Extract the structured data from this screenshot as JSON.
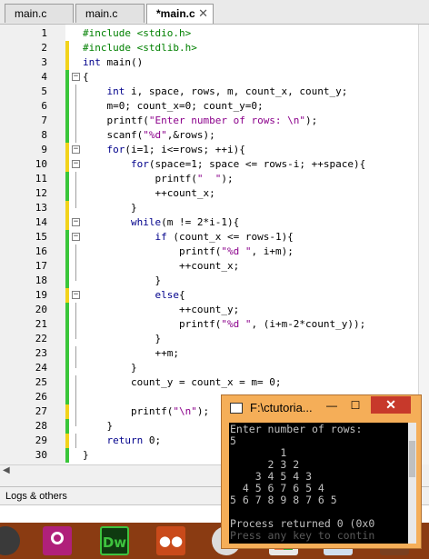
{
  "tabs": [
    {
      "label": "main.c",
      "active": false
    },
    {
      "label": "main.c",
      "active": false
    },
    {
      "label": "*main.c",
      "active": true
    }
  ],
  "editor": {
    "lines": [
      {
        "n": "1",
        "code": "#include <stdio.h>"
      },
      {
        "n": "2",
        "code": "#include <stdlib.h>"
      },
      {
        "n": "3",
        "code": "int main()"
      },
      {
        "n": "4",
        "code": "{"
      },
      {
        "n": "5",
        "code": "    int i, space, rows, m, count_x, count_y;"
      },
      {
        "n": "6",
        "code": "    m=0; count_x=0; count_y=0;"
      },
      {
        "n": "7",
        "code": "    printf(\"Enter number of rows: \\n\");"
      },
      {
        "n": "8",
        "code": "    scanf(\"%d\",&rows);"
      },
      {
        "n": "9",
        "code": "    for(i=1; i<=rows; ++i){"
      },
      {
        "n": "10",
        "code": "        for(space=1; space <= rows-i; ++space){"
      },
      {
        "n": "11",
        "code": "            printf(\"  \");"
      },
      {
        "n": "12",
        "code": "            ++count_x;"
      },
      {
        "n": "13",
        "code": "        }"
      },
      {
        "n": "14",
        "code": "        while(m != 2*i-1){"
      },
      {
        "n": "15",
        "code": "            if (count_x <= rows-1){"
      },
      {
        "n": "16",
        "code": "                printf(\"%d \", i+m);"
      },
      {
        "n": "17",
        "code": "                ++count_x;"
      },
      {
        "n": "18",
        "code": "            }"
      },
      {
        "n": "19",
        "code": "            else{"
      },
      {
        "n": "20",
        "code": "                ++count_y;"
      },
      {
        "n": "21",
        "code": "                printf(\"%d \", (i+m-2*count_y));"
      },
      {
        "n": "22",
        "code": "            }"
      },
      {
        "n": "23",
        "code": "            ++m;"
      },
      {
        "n": "24",
        "code": "        }"
      },
      {
        "n": "25",
        "code": "        count_y = count_x = m= 0;"
      },
      {
        "n": "26",
        "code": ""
      },
      {
        "n": "27",
        "code": "        printf(\"\\n\");"
      },
      {
        "n": "28",
        "code": "    }"
      },
      {
        "n": "29",
        "code": "    return 0;"
      },
      {
        "n": "30",
        "code": "}"
      }
    ]
  },
  "logs_tab": "Logs & others",
  "console": {
    "title": "F:\\ctutoria...",
    "minimize": "—",
    "maximize": "☐",
    "close": "✕",
    "lines": [
      "Enter number of rows:",
      "5",
      "        1",
      "      2 3 2",
      "    3 4 5 4 3",
      "  4 5 6 7 6 5 4",
      "5 6 7 8 9 8 7 6 5",
      "",
      "Process returned 0 (0x0",
      "Press any key to contin"
    ]
  },
  "taskbar": {
    "icons": [
      "chrome-icon",
      "camera-app-icon",
      "dreamweaver-icon",
      "codeblocks-icon",
      "people-icon",
      "chrome-icon",
      "office-icon",
      "app-icon",
      "app-icon"
    ],
    "dw_label": "Dw"
  },
  "colors": {
    "change_green": "#3ac63a",
    "change_yellow": "#f2d31b",
    "keyword": "#00008b",
    "preprocessor": "#008000",
    "string": "#8b008b",
    "operator": "#c00000"
  }
}
